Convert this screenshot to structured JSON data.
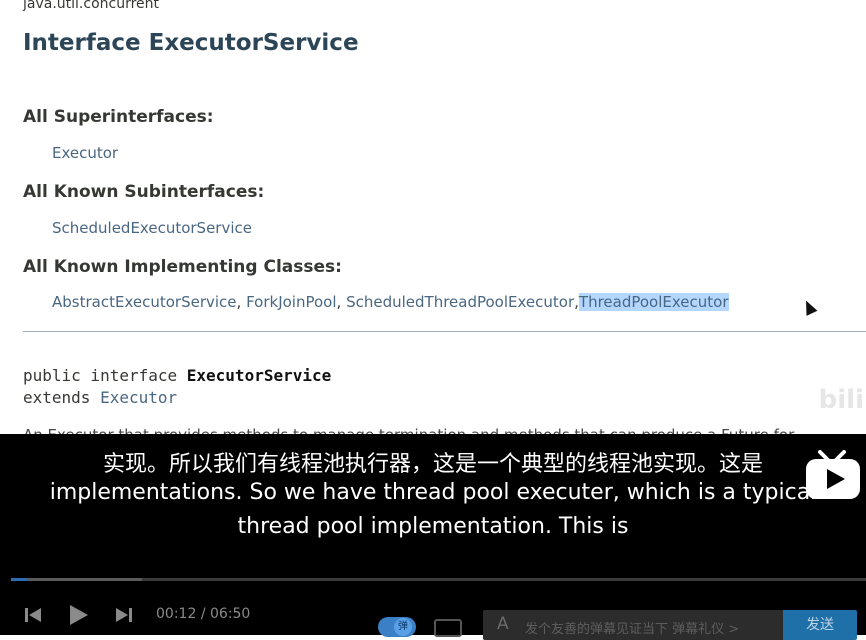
{
  "doc": {
    "package": "java.util.concurrent",
    "title": "Interface ExecutorService",
    "superinterfaces_label": "All Superinterfaces:",
    "superinterfaces": [
      "Executor"
    ],
    "subinterfaces_label": "All Known Subinterfaces:",
    "subinterfaces": [
      "ScheduledExecutorService"
    ],
    "implementing_label": "All Known Implementing Classes:",
    "implementing": [
      "AbstractExecutorService",
      "ForkJoinPool",
      "ScheduledThreadPoolExecutor",
      "ThreadPoolExecutor"
    ],
    "separator": ",",
    "declaration": {
      "line1_prefix": "public interface ",
      "line1_name": "ExecutorService",
      "line2_prefix": "extends ",
      "line2_link": "Executor"
    },
    "partial_text": "An Executor that provides methods to manage termination and methods that can produce a Future for",
    "watermark": "bili"
  },
  "player": {
    "subtitle_zh": "实现。所以我们有线程池执行器，这是一个典型的线程池实现。这是",
    "subtitle_en_1": "implementations. So we have thread pool executer, which is a typical",
    "subtitle_en_2": "thread pool implementation. This is",
    "progress_fraction": 0.019,
    "buffered_fraction": 0.153,
    "time_current": "00:12",
    "time_sep": "/",
    "time_total": "06:50",
    "danmu_toggle_label": "弹",
    "danmu_placeholder": "发个友善的弹幕见证当下 弹幕礼仪 >",
    "danmu_font_icon": "A",
    "send_label": "发送",
    "accent_color": "#3b7fc4"
  }
}
